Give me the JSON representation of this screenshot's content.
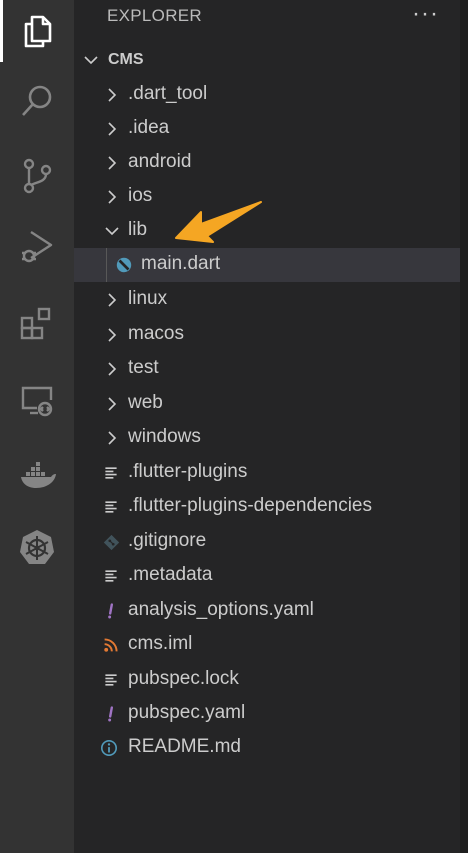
{
  "sidebar": {
    "header": "EXPLORER",
    "more_actions": "···",
    "root_folder": "CMS"
  },
  "activity_bar": {
    "items": [
      "files-icon",
      "search-icon",
      "source-control-icon",
      "run-debug-icon",
      "extensions-icon",
      "remote-explorer-icon",
      "docker-icon",
      "kubernetes-icon"
    ]
  },
  "tree": {
    "items": [
      {
        "label": ".dart_tool",
        "type": "folder",
        "expanded": false
      },
      {
        "label": ".idea",
        "type": "folder",
        "expanded": false
      },
      {
        "label": "android",
        "type": "folder",
        "expanded": false
      },
      {
        "label": "ios",
        "type": "folder",
        "expanded": false
      },
      {
        "label": "lib",
        "type": "folder",
        "expanded": true
      },
      {
        "label": "main.dart",
        "type": "dart-file",
        "selected": true
      },
      {
        "label": "linux",
        "type": "folder",
        "expanded": false
      },
      {
        "label": "macos",
        "type": "folder",
        "expanded": false
      },
      {
        "label": "test",
        "type": "folder",
        "expanded": false
      },
      {
        "label": "web",
        "type": "folder",
        "expanded": false
      },
      {
        "label": "windows",
        "type": "folder",
        "expanded": false
      },
      {
        "label": ".flutter-plugins",
        "type": "text-file"
      },
      {
        "label": ".flutter-plugins-dependencies",
        "type": "text-file"
      },
      {
        "label": ".gitignore",
        "type": "git-file"
      },
      {
        "label": ".metadata",
        "type": "text-file"
      },
      {
        "label": "analysis_options.yaml",
        "type": "yaml-file"
      },
      {
        "label": "cms.iml",
        "type": "rss-file"
      },
      {
        "label": "pubspec.lock",
        "type": "text-file"
      },
      {
        "label": "pubspec.yaml",
        "type": "yaml-file"
      },
      {
        "label": "README.md",
        "type": "info-file"
      }
    ]
  },
  "colors": {
    "activity_bar_bg": "#333333",
    "sidebar_bg": "#252526",
    "selected_row_bg": "#37373d",
    "annotation_arrow": "#f5a623",
    "yaml_icon": "#a074c4",
    "rss_icon": "#e37933",
    "info_icon": "#519aba",
    "dart_icon": "#519aba"
  },
  "annotation": {
    "icon": "arrow-pointing-left-icon",
    "target": "lib"
  }
}
